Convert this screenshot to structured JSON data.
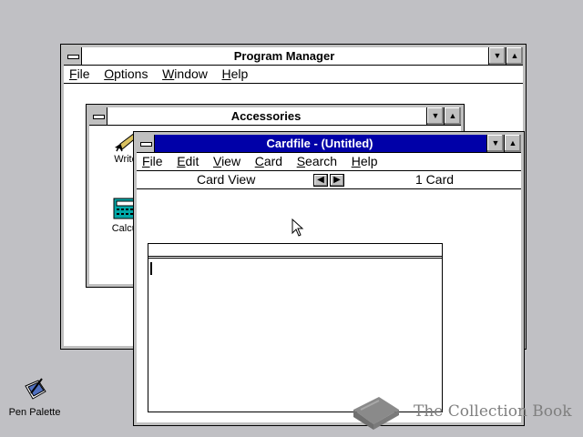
{
  "program_manager": {
    "title": "Program Manager",
    "menu": [
      "File",
      "Options",
      "Window",
      "Help"
    ]
  },
  "accessories": {
    "title": "Accessories",
    "icons": [
      {
        "label": "Write",
        "visible_label": "Write",
        "icon": "write-pen-icon"
      },
      {
        "label": "Calculator",
        "visible_label": "Calcul",
        "icon": "calculator-icon"
      }
    ]
  },
  "cardfile": {
    "title": "Cardfile - (Untitled)",
    "menu": [
      "File",
      "Edit",
      "View",
      "Card",
      "Search",
      "Help"
    ],
    "view_label": "Card View",
    "card_count": "1 Card",
    "prev_icon": "left-arrow-icon",
    "next_icon": "right-arrow-icon"
  },
  "desktop": {
    "pen_palette_label": "Pen Palette",
    "watermark_text": "The Collection Book"
  },
  "colors": {
    "desktop": "#c0c0c4",
    "active_title": "#0000a8",
    "window_bg": "#ffffff"
  }
}
